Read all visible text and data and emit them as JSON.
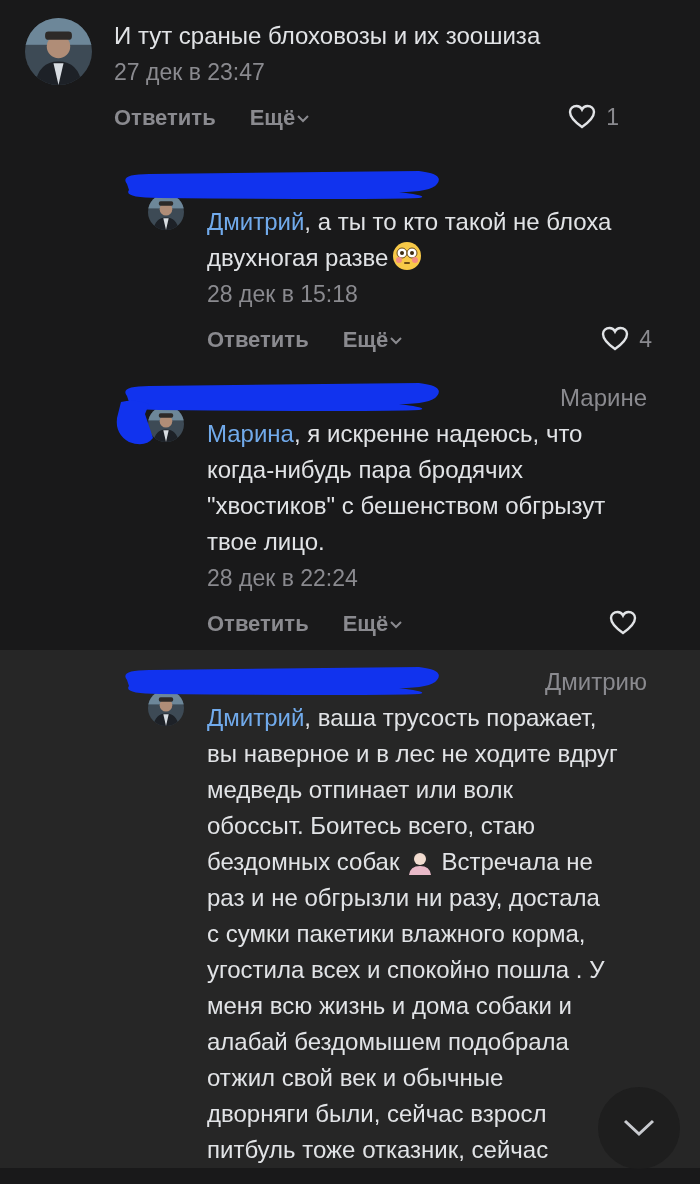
{
  "comment": {
    "lines": [
      {
        "kind": "text",
        "text": "И тут сраные блоховозы и их зоошиза"
      }
    ],
    "date": "27 дек в 23:47",
    "reply": "Ответить",
    "more": "Ещё",
    "likes": "1",
    "liked": false,
    "replies": [
      {
        "author_redacted": true,
        "highlighted": false,
        "lines": [
          {
            "kind": "text",
            "mention": "Дмитрий",
            "text": ", а ты то кто такой не блоха"
          },
          {
            "kind": "flushed_emoji",
            "text": "двухногая разве"
          }
        ],
        "date": "28 дек в 15:18",
        "reply": "Ответить",
        "more": "Ещё",
        "likes": "4",
        "liked": false
      },
      {
        "author_redacted": true,
        "highlighted": false,
        "reply_to": "Марине",
        "lines": [
          {
            "kind": "text",
            "mention": "Марина",
            "text": ", я искренне надеюсь, что"
          },
          {
            "kind": "text",
            "text": "когда-нибудь пара бродячих"
          },
          {
            "kind": "text",
            "text": "\"хвостиков\" с бешенством обгрызут"
          },
          {
            "kind": "text",
            "text": "твое лицо."
          }
        ],
        "date": "28 дек в 22:24",
        "reply": "Ответить",
        "more": "Ещё",
        "liked": false
      },
      {
        "author_redacted": true,
        "highlighted": true,
        "reply_to": "Дмитрию",
        "lines": [
          {
            "kind": "text",
            "mention": "Дмитрий",
            "text": ", ваша трусость поражает,"
          },
          {
            "kind": "text",
            "text": "вы наверное и в лес не ходите вдруг"
          },
          {
            "kind": "text",
            "text": "медведь отпинает или волк"
          },
          {
            "kind": "text",
            "text": "обоссыт. Боитесь всего, стаю"
          },
          {
            "kind": "person_emoji",
            "text": "бездомных собак",
            "after": "Встречала не"
          },
          {
            "kind": "text",
            "text": "раз и не обгрызли ни разу, достала"
          },
          {
            "kind": "text",
            "text": "с сумки пакетики влажного корма,"
          },
          {
            "kind": "text",
            "text": "угостила всех и спокойно пошла . У"
          },
          {
            "kind": "text",
            "text": "меня всю жизнь и дома собаки и"
          },
          {
            "kind": "text",
            "text": "алабай бездомышем подобрала"
          },
          {
            "kind": "text",
            "text": "отжил свой век и обычные"
          },
          {
            "kind": "text",
            "text": "дворняги были, сейчас взросл"
          },
          {
            "kind": "text",
            "text": "питбуль тоже отказник, сейчас"
          }
        ]
      }
    ]
  },
  "scroll_down_button": true
}
